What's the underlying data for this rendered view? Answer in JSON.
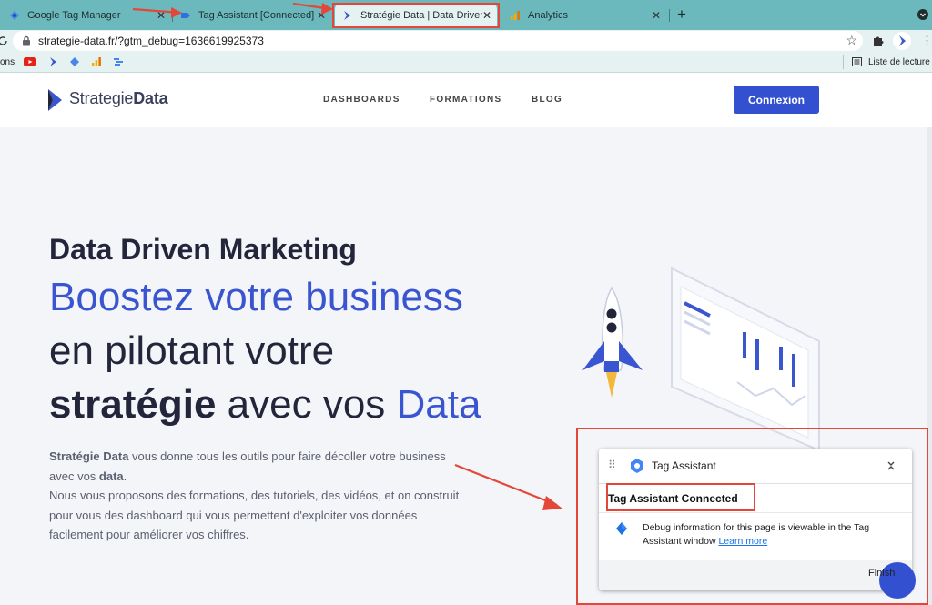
{
  "browser": {
    "tabs": [
      {
        "title": "Google Tag Manager"
      },
      {
        "title": "Tag Assistant [Connected]"
      },
      {
        "title": "Stratégie Data | Data Driven Ma"
      },
      {
        "title": "Analytics"
      }
    ],
    "new_tab_label": "+",
    "url": "strategie-data.fr/?gtm_debug=1636619925373",
    "bookmarks_left_label": "ons",
    "reading_list_label": "Liste de lecture"
  },
  "site": {
    "logo_regular": "Strategie",
    "logo_bold": "Data",
    "nav": [
      "DASHBOARDS",
      "FORMATIONS",
      "BLOG"
    ],
    "login_button": "Connexion"
  },
  "hero": {
    "kicker": "Data Driven Marketing",
    "line1": "Boostez votre business",
    "line2": "en pilotant votre",
    "line3_strong": "stratégie",
    "line3_mid": " avec vos ",
    "line3_blue": "Data",
    "desc_strong1": "Stratégie Data",
    "desc_part1": " vous donne tous les outils pour faire décoller votre business avec vos ",
    "desc_strong2": "data",
    "desc_part2": ".",
    "desc_part3": "Nous vous proposons des formations, des tutoriels, des vidéos, et on construit pour vous des dashboard qui vous permettent d'exploiter vos données facilement pour améliorer vos chiffres."
  },
  "tag_assistant": {
    "title": "Tag Assistant",
    "status": "Tag Assistant Connected",
    "body": "Debug information for this page is viewable in the Tag Assistant window",
    "learn_more": "Learn more",
    "finish": "Finish"
  },
  "colors": {
    "tab_bar": "#6bb9bd",
    "brand_blue": "#3350d1",
    "annotation_red": "#e4473a"
  }
}
